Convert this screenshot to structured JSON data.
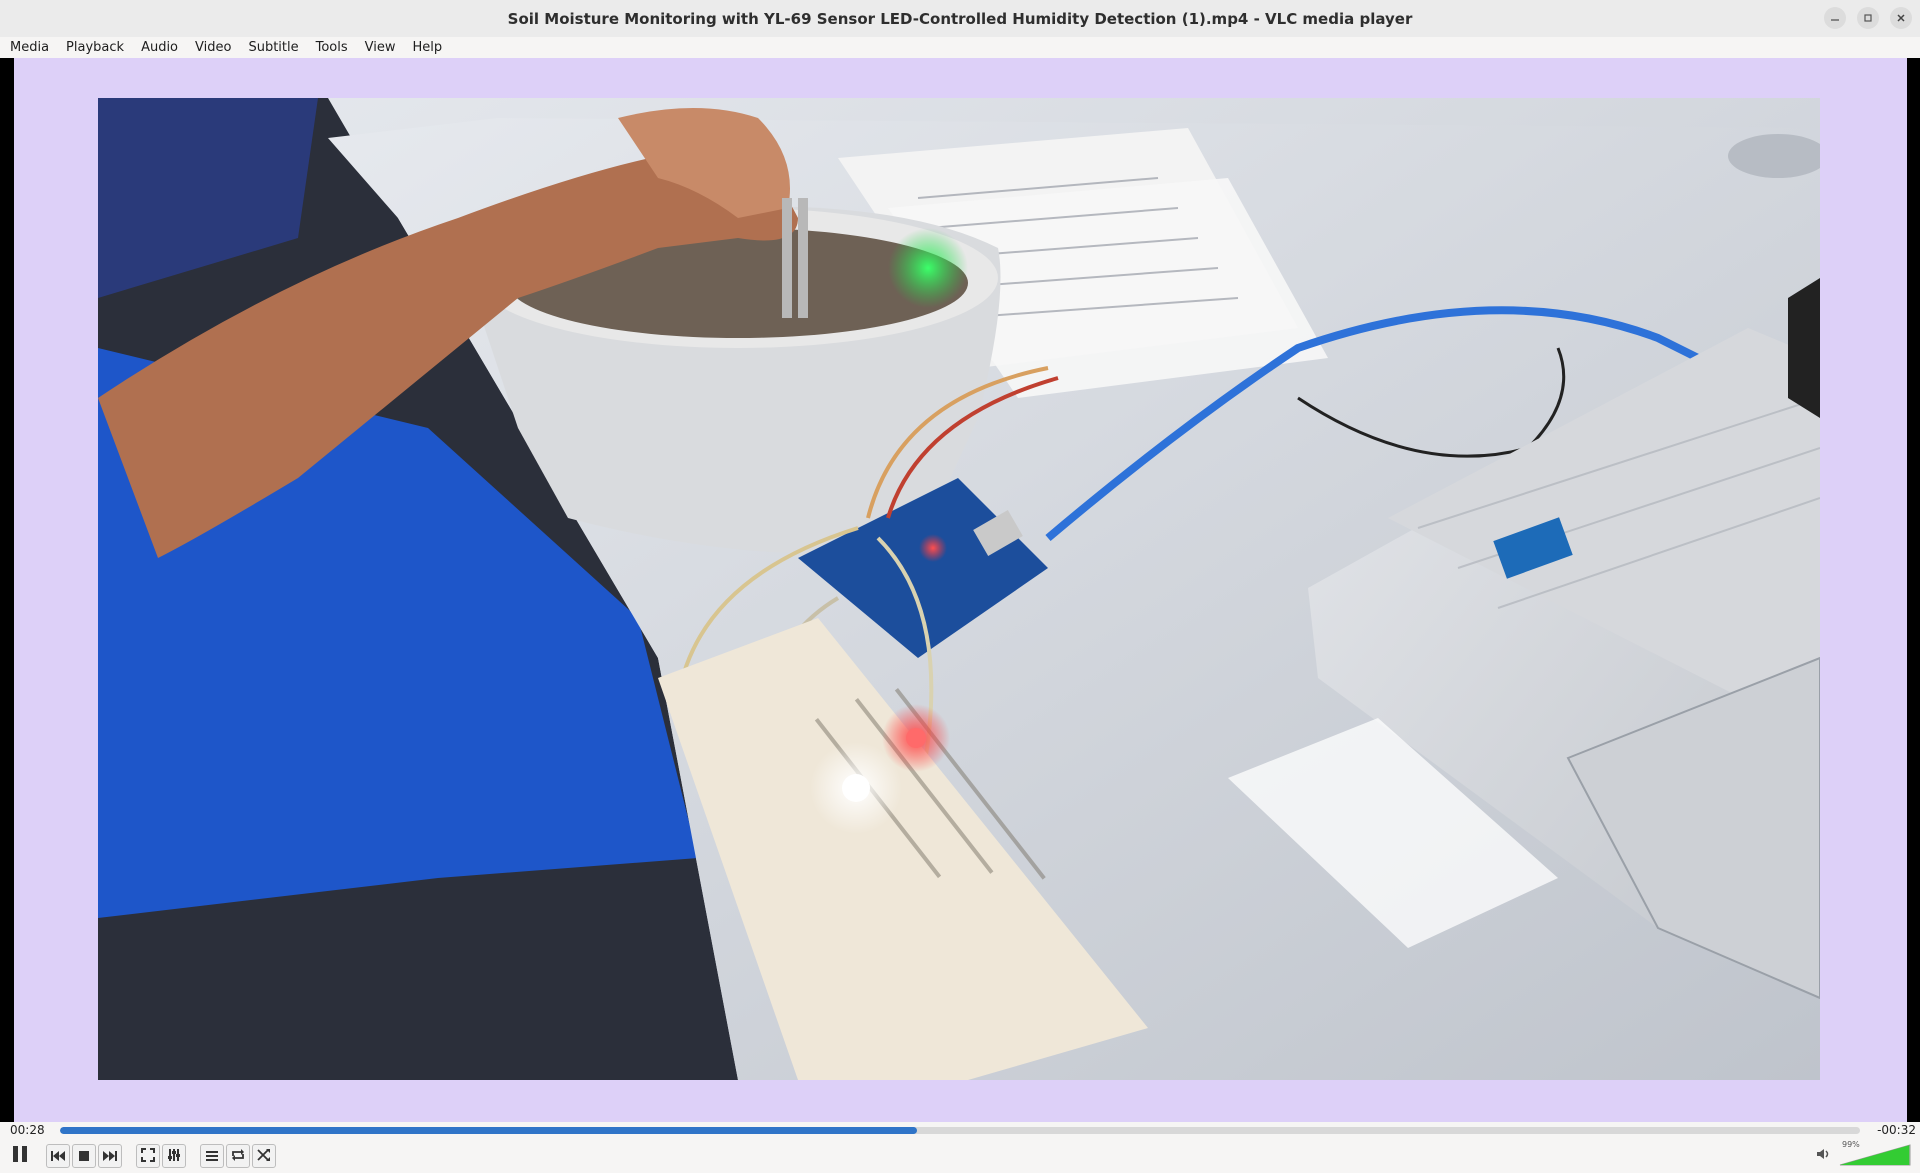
{
  "window": {
    "title": "Soil Moisture Monitoring with YL-69 Sensor LED-Controlled Humidity Detection (1).mp4 - VLC media player",
    "buttons": [
      "minimize-icon",
      "restore-icon",
      "close-icon"
    ]
  },
  "menu": [
    "Media",
    "Playback",
    "Audio",
    "Video",
    "Subtitle",
    "Tools",
    "View",
    "Help"
  ],
  "video": {
    "description": "video frame showing hand inserting YL-69 soil moisture probe into a pot of soil, wired to an Arduino board and breadboard with white and red LEDs, laptop on the right"
  },
  "playback": {
    "elapsed": "00:28",
    "remaining": "-00:32",
    "progress_fraction": 0.476
  },
  "controls": {
    "icons": [
      "pause-icon",
      "previous-icon",
      "stop-icon",
      "next-icon",
      "fullscreen-icon",
      "extended-settings-icon",
      "playlist-icon",
      "loop-icon",
      "shuffle-icon"
    ]
  },
  "volume": {
    "label": "99%",
    "level_fraction": 0.99,
    "color": "#33cc33"
  },
  "colors": {
    "video_background": "#ddd0f8",
    "seek_fill": "#2f74c8"
  }
}
